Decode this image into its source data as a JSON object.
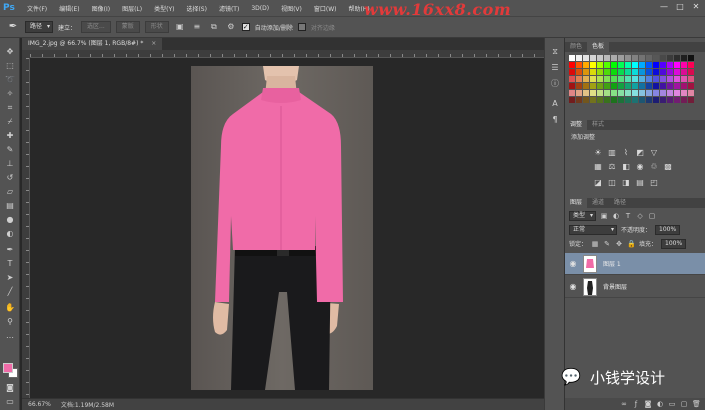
{
  "app": {
    "logo": "Ps",
    "menu": [
      "文件(F)",
      "编辑(E)",
      "图像(I)",
      "图层(L)",
      "类型(Y)",
      "选择(S)",
      "滤镜(T)",
      "3D(D)",
      "视图(V)",
      "窗口(W)",
      "帮助(H)"
    ],
    "watermark": "www.16xx8.com",
    "window_buttons": [
      "—",
      "□",
      "✕"
    ]
  },
  "options": {
    "mode_select": "路径",
    "build_label": "建立：",
    "selection_btn": "选区...",
    "mask_btn": "蒙版",
    "shape_btn": "形状",
    "auto_add_label": "自动添加/删除",
    "align_edges_label": "对齐边缘"
  },
  "document": {
    "tab_title": "IMG_2.jpg @ 66.7% (图层 1, RGB/8#) *",
    "tab_close": "×",
    "zoom": "66.67%",
    "doc_info": "文档:1.19M/2.58M"
  },
  "panels": {
    "swatches_tabs": [
      "颜色",
      "色板"
    ],
    "adjust_tabs": [
      "调整",
      "样式"
    ],
    "adjust_title": "添加调整",
    "layers_tabs": [
      "图层",
      "通道",
      "路径"
    ],
    "kind_select": "类型",
    "blend_select": "正常",
    "opacity_label": "不透明度：",
    "opacity_value": "100%",
    "lock_label": "锁定：",
    "fill_label": "填充：",
    "fill_value": "100%",
    "layers": [
      {
        "name": "图层 1",
        "selected": true
      },
      {
        "name": "背景图层",
        "selected": false
      }
    ]
  },
  "badge": {
    "icon": "wechat-icon",
    "text": "小钱学设计"
  },
  "colors": {
    "shirt": "#f06ba8",
    "fg_color": "#f06ba8",
    "bg_color": "#ffffff",
    "ps_blue": "#3fa8f5",
    "watermark_red": "#e23a3a",
    "selected_layer": "#7a8fa8"
  }
}
